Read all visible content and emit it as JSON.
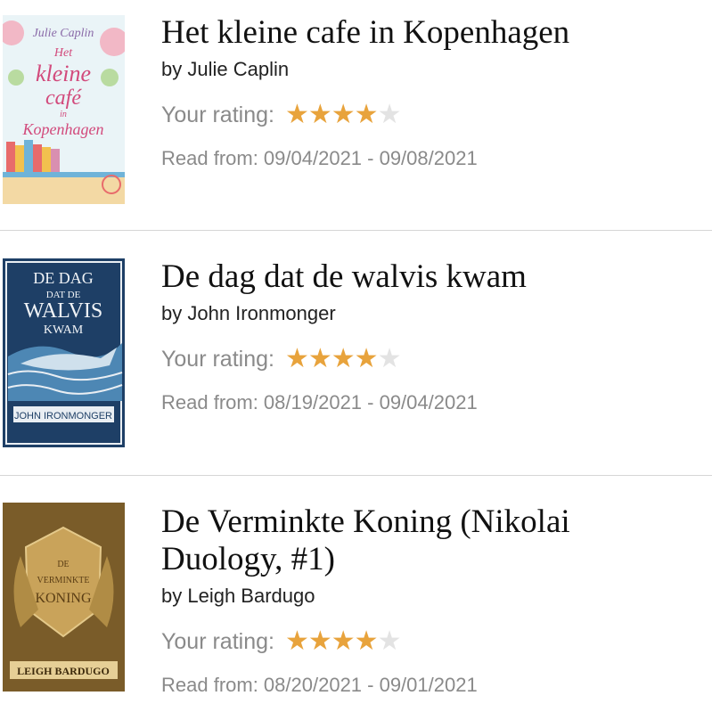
{
  "books": [
    {
      "title": "Het kleine cafe in Kopenhagen",
      "author": "by Julie Caplin",
      "rating_label": "Your rating:",
      "rating": 4,
      "rating_max": 5,
      "read": "Read from: 09/04/2021 - 09/08/2021",
      "cover": {
        "author": "Julie Caplin",
        "lines": [
          "Het",
          "kleine",
          "café",
          "in",
          "Kopenhagen"
        ]
      }
    },
    {
      "title": "De dag dat de walvis kwam",
      "author": "by John Ironmonger",
      "rating_label": "Your rating:",
      "rating": 4,
      "rating_max": 5,
      "read": "Read from: 08/19/2021 - 09/04/2021",
      "cover": {
        "lines": [
          "DE DAG",
          "DAT DE",
          "WALVIS",
          "KWAM"
        ],
        "author": "JOHN IRONMONGER"
      }
    },
    {
      "title": "De Verminkte Koning (Nikolai Duology, #1)",
      "author": "by Leigh Bardugo",
      "rating_label": "Your rating:",
      "rating": 4,
      "rating_max": 5,
      "read": "Read from: 08/20/2021 - 09/01/2021",
      "cover": {
        "lines": [
          "DE",
          "VERMINKTE",
          "KONING"
        ],
        "author": "LEIGH BARDUGO"
      }
    }
  ],
  "colors": {
    "star_on": "#e8a33c",
    "star_off": "#e3e3e3",
    "muted_text": "#8a8a8a"
  }
}
